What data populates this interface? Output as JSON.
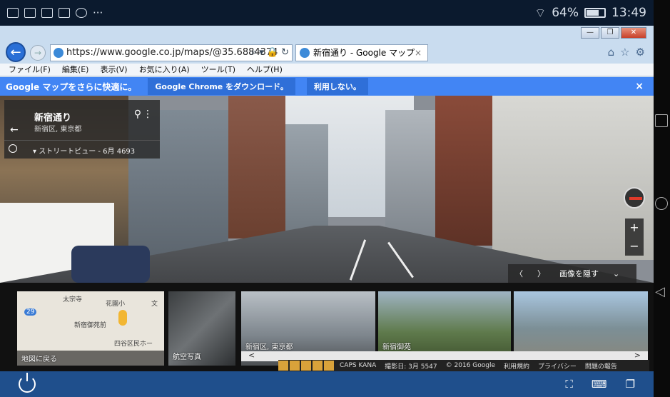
{
  "status": {
    "battery": "64%",
    "battery_level": 0.64,
    "time": "13:49",
    "more": "···"
  },
  "browser": {
    "url": "https://www.google.co.jp/maps/@35.6884374",
    "url_tools": "⌕ ▾ 🔒 ↻",
    "tab_title": "新宿通り - Google マップ",
    "tab_close": "×",
    "window_controls": {
      "minimize": "—",
      "maximize": "❐",
      "close": "✕"
    },
    "toolbar_icons": {
      "home": "⌂",
      "favorites": "☆",
      "settings": "⚙"
    }
  },
  "menu": [
    "ファイル(F)",
    "編集(E)",
    "表示(V)",
    "お気に入り(A)",
    "ツール(T)",
    "ヘルプ(H)"
  ],
  "infobar": {
    "title": "Google マップをさらに快適に。",
    "download": "Google Chrome をダウンロード。",
    "decline": "利用しない。",
    "close": "×"
  },
  "place": {
    "back": "←",
    "name": "新宿通り",
    "area": "新宿区, 東京都",
    "history": "▾  ストリートビュー - 6月 4693",
    "pin": "⚲",
    "more": "⋮"
  },
  "viewer": {
    "zoom_in": "+",
    "zoom_out": "−",
    "prev": "〈",
    "next": "〉",
    "hide_images": "画像を隠す",
    "collapse": "⌄"
  },
  "thumbnails": {
    "back_to_map": "地図に戻る",
    "aerial": "航空写真",
    "t3": "新宿区, 東京都",
    "t4": "新宿御苑",
    "map_labels": {
      "a": "太宗寺",
      "b": "花園小",
      "c": "新宿御苑前",
      "d": "四谷区民ホー",
      "e": "29",
      "f": "文"
    }
  },
  "scroll": {
    "left": "<",
    "right": ">"
  },
  "footer": {
    "caps": "CAPS KANA",
    "date": "撮影日: 3月 5547",
    "copyright": "© 2016 Google",
    "terms": "利用規約",
    "privacy": "プライバシー",
    "report": "問題の報告"
  }
}
